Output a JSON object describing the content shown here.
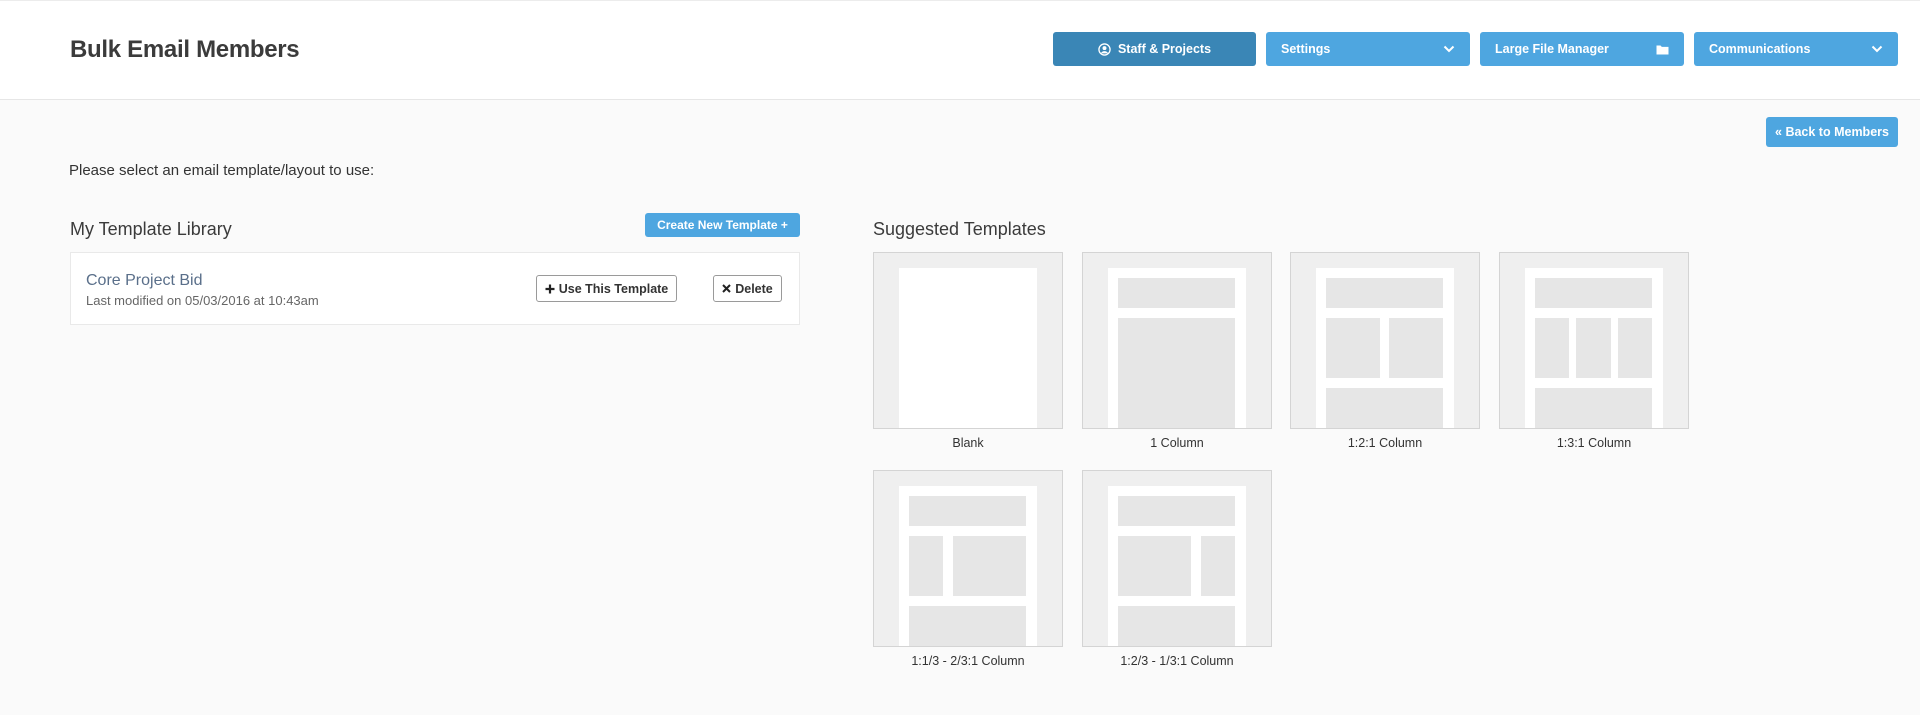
{
  "header": {
    "title": "Bulk Email Members",
    "nav": [
      {
        "label": "Staff & Projects",
        "icon": "user-circle-icon"
      },
      {
        "label": "Settings",
        "icon": "chevron-down-icon"
      },
      {
        "label": "Large File Manager",
        "icon": "folder-icon"
      },
      {
        "label": "Communications",
        "icon": "chevron-down-icon"
      }
    ]
  },
  "actions": {
    "back_label": "« Back to Members"
  },
  "instruction": "Please select an email template/layout to use:",
  "library": {
    "title": "My Template Library",
    "create_label": "Create New Template +",
    "templates": [
      {
        "name": "Core Project Bid",
        "modified": "Last modified on 05/03/2016 at 10:43am",
        "use_label": "Use This Template",
        "delete_label": "Delete"
      }
    ]
  },
  "suggested": {
    "title": "Suggested Templates",
    "items": [
      {
        "label": "Blank"
      },
      {
        "label": "1 Column"
      },
      {
        "label": "1:2:1 Column"
      },
      {
        "label": "1:3:1 Column"
      },
      {
        "label": "1:1/3 - 2/3:1 Column"
      },
      {
        "label": "1:2/3 - 1/3:1 Column"
      }
    ]
  },
  "colors": {
    "accent": "#4ea6e0",
    "accent_dark": "#3a86b6"
  }
}
